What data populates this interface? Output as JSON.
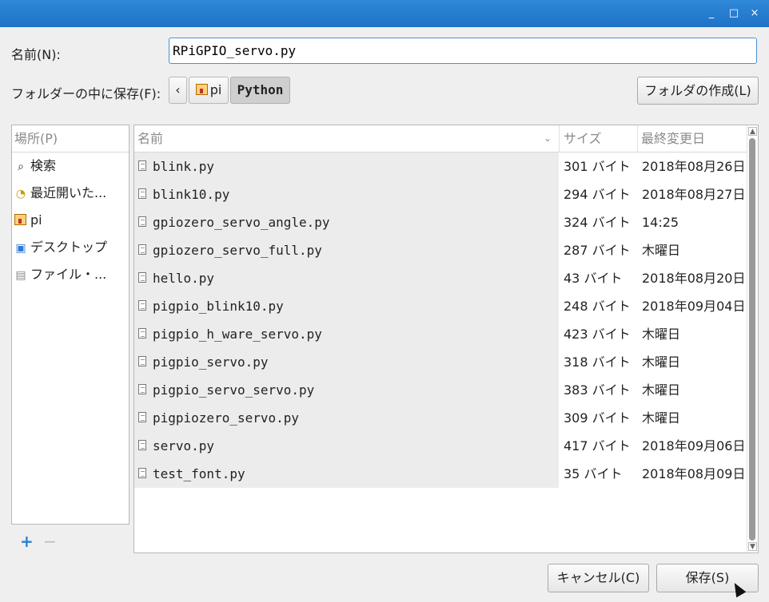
{
  "window": {
    "minimize": "_",
    "maximize": "□",
    "close": "×"
  },
  "name_label": "名前(N):",
  "filename": "RPiGPIO_servo.py",
  "folder_label": "フォルダーの中に保存(F):",
  "breadcrumb": {
    "back": "‹",
    "home": "pi",
    "current": "Python"
  },
  "create_folder_label": "フォルダの作成(L)",
  "places": {
    "header": "場所(P)",
    "items": [
      {
        "icon": "search-icon",
        "label": "検索"
      },
      {
        "icon": "recent-icon",
        "label": "最近開いた..."
      },
      {
        "icon": "home-icon",
        "label": "pi"
      },
      {
        "icon": "desktop-icon",
        "label": "デスクトップ"
      },
      {
        "icon": "filesystem-icon",
        "label": "ファイル・..."
      }
    ],
    "add": "+",
    "remove": "−"
  },
  "columns": {
    "name": "名前",
    "size": "サイズ",
    "modified": "最終変更日"
  },
  "files": [
    {
      "name": "blink.py",
      "size": "301 バイト",
      "date": "2018年08月26日"
    },
    {
      "name": "blink10.py",
      "size": "294 バイト",
      "date": "2018年08月27日"
    },
    {
      "name": "gpiozero_servo_angle.py",
      "size": "324 バイト",
      "date": "14:25"
    },
    {
      "name": "gpiozero_servo_full.py",
      "size": "287 バイト",
      "date": "木曜日"
    },
    {
      "name": "hello.py",
      "size": "43 バイト",
      "date": "2018年08月20日"
    },
    {
      "name": "pigpio_blink10.py",
      "size": "248 バイト",
      "date": "2018年09月04日"
    },
    {
      "name": "pigpio_h_ware_servo.py",
      "size": "423 バイト",
      "date": "木曜日"
    },
    {
      "name": "pigpio_servo.py",
      "size": "318 バイト",
      "date": "木曜日"
    },
    {
      "name": "pigpio_servo_servo.py",
      "size": "383 バイト",
      "date": "木曜日"
    },
    {
      "name": "pigpiozero_servo.py",
      "size": "309 バイト",
      "date": "木曜日"
    },
    {
      "name": "servo.py",
      "size": "417 バイト",
      "date": "2018年09月06日"
    },
    {
      "name": "test_font.py",
      "size": "35 バイト",
      "date": "2018年08月09日"
    }
  ],
  "buttons": {
    "cancel": "キャンセル(C)",
    "save": "保存(S)"
  },
  "colors": {
    "titlebar": "#1f72c6",
    "row_bg": "#ececec",
    "accent": "#4a90d9"
  }
}
